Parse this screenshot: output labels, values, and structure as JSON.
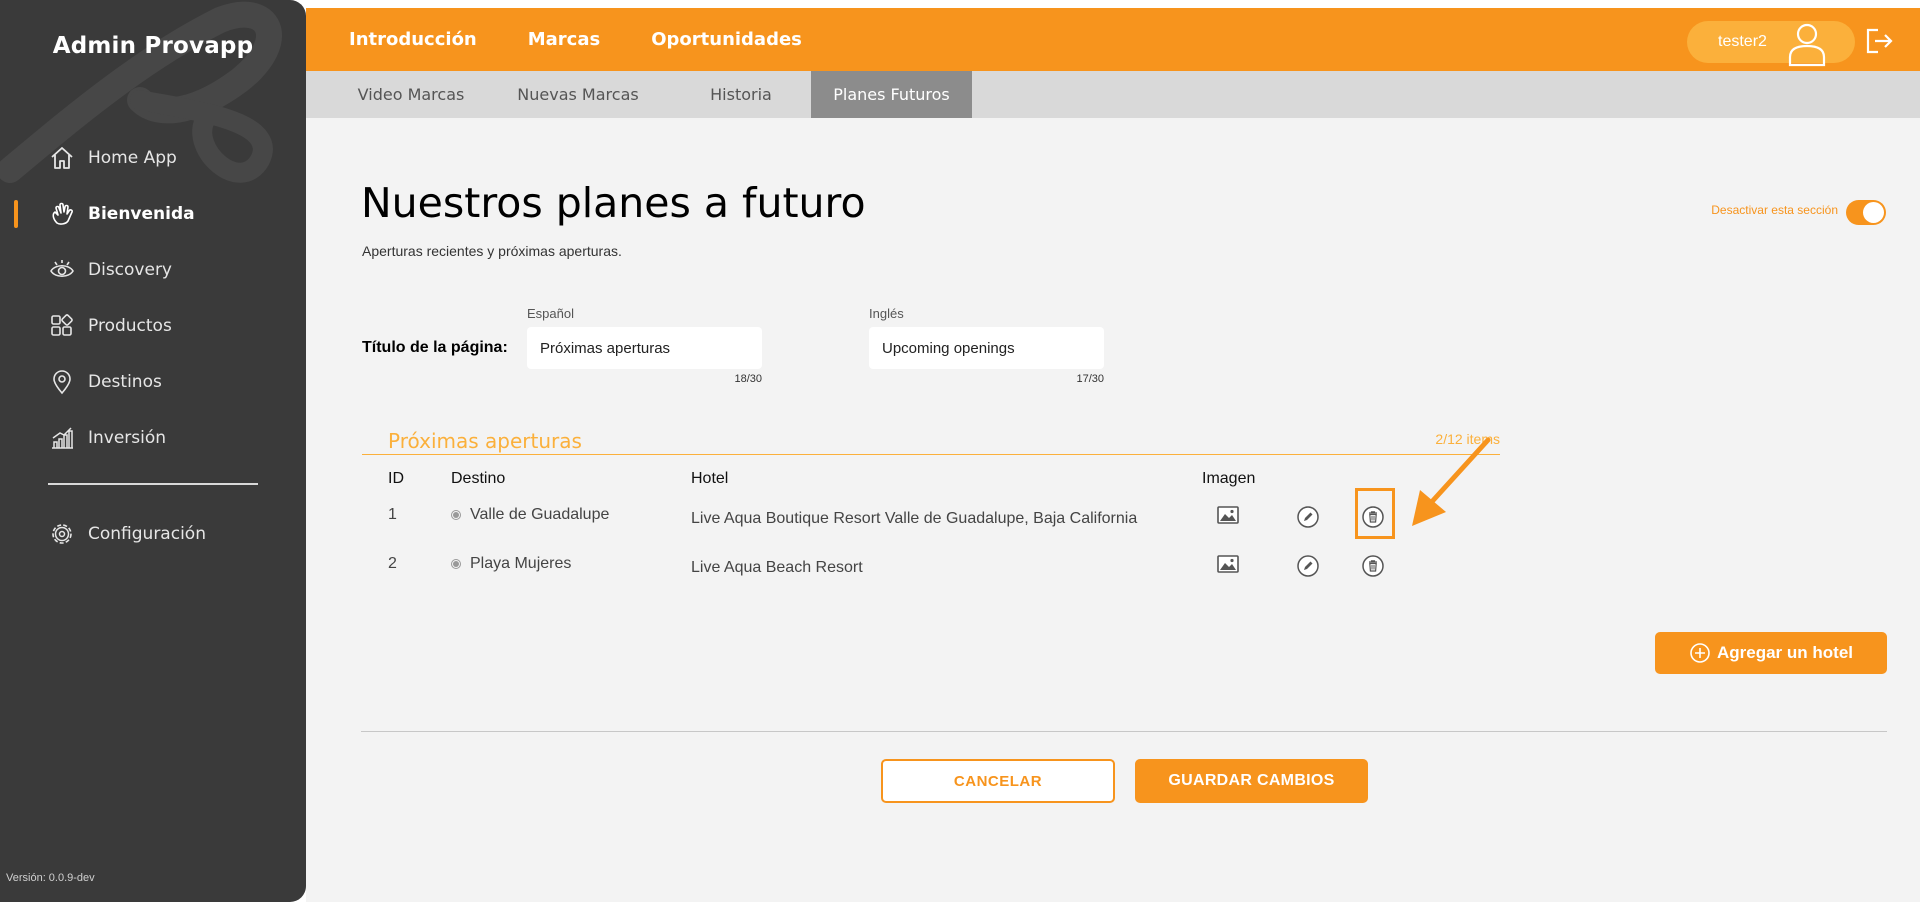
{
  "app": {
    "brand": "Admin Provapp",
    "version": "Versión: 0.0.9-dev",
    "accent": "#f7941d"
  },
  "sidebar": {
    "items": [
      {
        "label": "Home App",
        "icon": "home-icon",
        "active": false
      },
      {
        "label": "Bienvenida",
        "icon": "waving-hand-icon",
        "active": true
      },
      {
        "label": "Discovery",
        "icon": "eye-icon",
        "active": false
      },
      {
        "label": "Productos",
        "icon": "grid-icon",
        "active": false
      },
      {
        "label": "Destinos",
        "icon": "location-pin-icon",
        "active": false
      },
      {
        "label": "Inversión",
        "icon": "bar-chart-icon",
        "active": false
      }
    ],
    "config": {
      "label": "Configuración",
      "icon": "gear-icon"
    }
  },
  "topnav": {
    "items": [
      "Introducción",
      "Marcas",
      "Oportunidades"
    ],
    "active": "Marcas",
    "user": "tester2"
  },
  "subnav": {
    "items": [
      "Video Marcas",
      "Nuevas Marcas",
      "Historia",
      "Planes Futuros"
    ],
    "active": "Planes Futuros"
  },
  "page": {
    "title": "Nuestros planes a futuro",
    "subtitle": "Aperturas recientes y próximas aperturas.",
    "toggle_label": "Desactivar esta sección",
    "toggle_on": true
  },
  "title_field": {
    "label": "Título de la página:",
    "es": {
      "label": "Español",
      "value": "Próximas aperturas",
      "count": "18/30"
    },
    "en": {
      "label": "Inglés",
      "value": "Upcoming openings",
      "count": "17/30"
    }
  },
  "section": {
    "title": "Próximas aperturas",
    "count": "2/12 items",
    "headers": {
      "id": "ID",
      "destino": "Destino",
      "hotel": "Hotel",
      "imagen": "Imagen"
    },
    "rows": [
      {
        "id": "1",
        "destino": "Valle de Guadalupe",
        "hotel": "Live Aqua Boutique Resort Valle de Guadalupe, Baja California"
      },
      {
        "id": "2",
        "destino": "Playa Mujeres",
        "hotel": "Live Aqua Beach Resort"
      }
    ]
  },
  "actions": {
    "add_hotel": "Agregar un hotel",
    "cancel": "CANCELAR",
    "save": "GUARDAR CAMBIOS"
  }
}
